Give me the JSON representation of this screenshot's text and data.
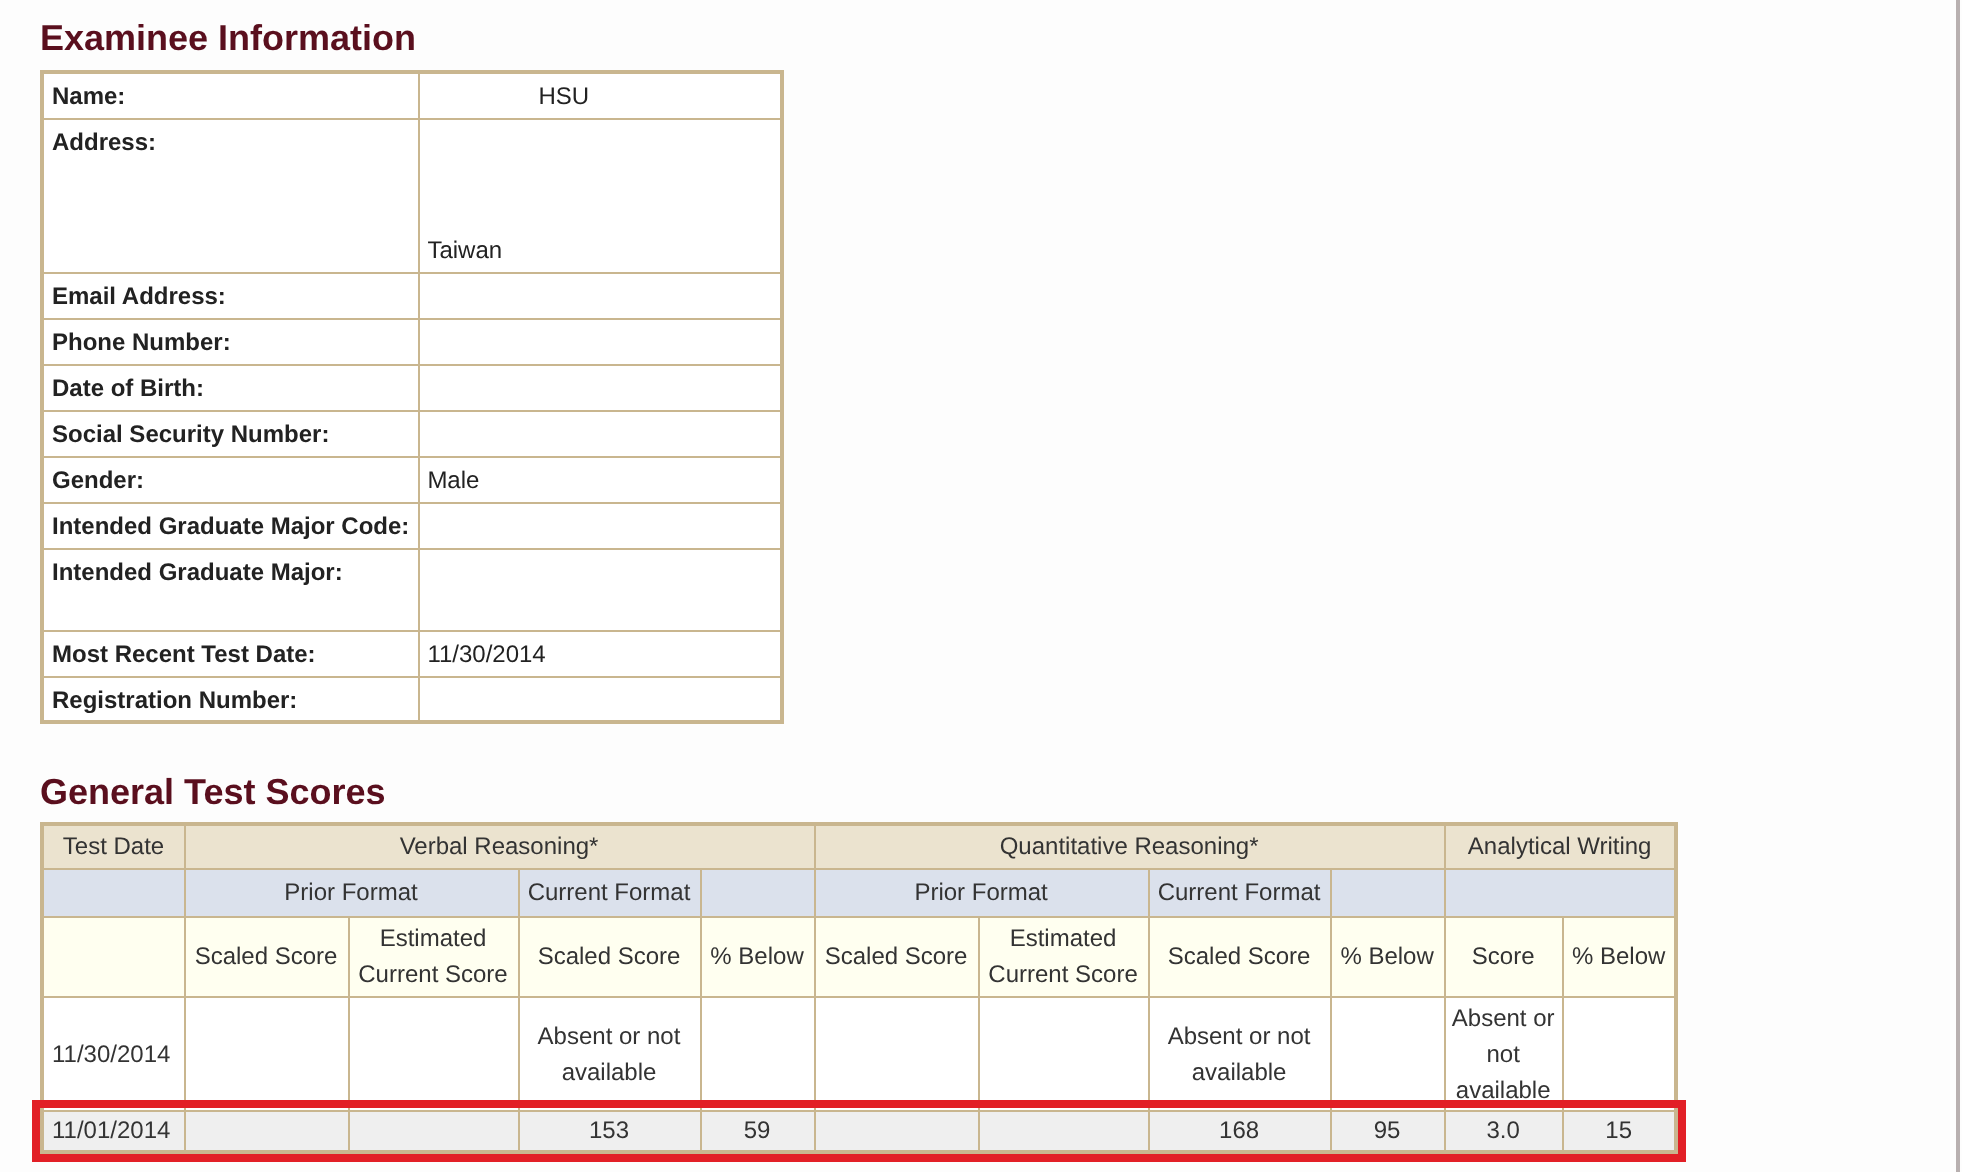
{
  "examinee": {
    "title": "Examinee Information",
    "rows": [
      {
        "label": "Name:",
        "value": "HSU",
        "kind": "centered"
      },
      {
        "label": "Address:",
        "value": "Taiwan",
        "kind": "tall"
      },
      {
        "label": "Email Address:"
      },
      {
        "label": "Phone Number:"
      },
      {
        "label": "Date of Birth:"
      },
      {
        "label": "Social Security Number:"
      },
      {
        "label": "Gender:",
        "value": "Male"
      },
      {
        "label": "Intended Graduate Major Code:"
      },
      {
        "label": "Intended Graduate Major:",
        "kind": "medium"
      },
      {
        "label": "Most Recent Test Date:",
        "value": "11/30/2014"
      },
      {
        "label": "Registration Number:"
      }
    ]
  },
  "scores": {
    "title": "General Test Scores",
    "groups": [
      {
        "label": "Test Date"
      },
      {
        "label": "Verbal Reasoning*"
      },
      {
        "label": "Quantitative Reasoning*"
      },
      {
        "label": "Analytical Writing"
      }
    ],
    "formats": [
      {
        "label": "Prior Format"
      },
      {
        "label": "Current Format"
      },
      {
        "label": "Prior Format"
      },
      {
        "label": "Current Format"
      }
    ],
    "columns": [
      "",
      "Scaled Score",
      "Estimated Current Score",
      "Scaled Score",
      "% Below",
      "Scaled Score",
      "Estimated Current Score",
      "Scaled Score",
      "% Below",
      "Score",
      "% Below"
    ],
    "rows": [
      {
        "highlighted": false,
        "cells": [
          "11/30/2014",
          "",
          "",
          "Absent or not available",
          "",
          "",
          "",
          "Absent or not available",
          "",
          "Absent or not available",
          ""
        ]
      },
      {
        "highlighted": true,
        "cells": [
          "11/01/2014",
          "",
          "",
          "153",
          "59",
          "",
          "",
          "168",
          "95",
          "3.0",
          "15"
        ]
      }
    ]
  }
}
